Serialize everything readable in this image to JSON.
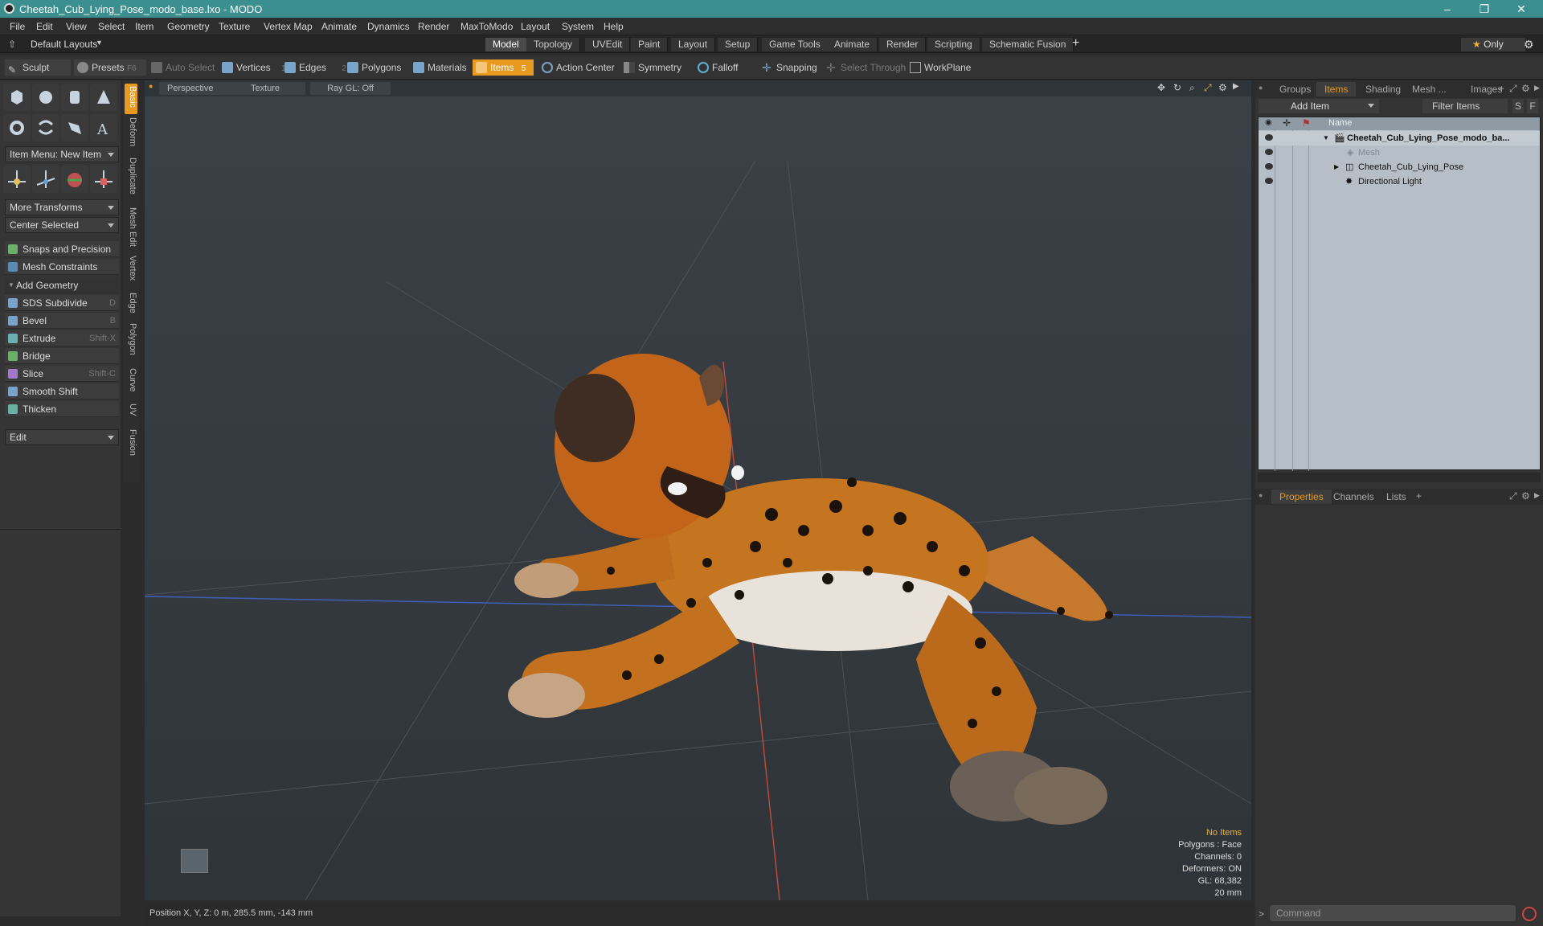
{
  "window": {
    "title": "Cheetah_Cub_Lying_Pose_modo_base.lxo - MODO",
    "controls": [
      "–",
      "❐",
      "✕"
    ]
  },
  "menu": [
    "File",
    "Edit",
    "View",
    "Select",
    "Item",
    "Geometry",
    "Texture",
    "Vertex Map",
    "Animate",
    "Dynamics",
    "Render",
    "MaxToModo",
    "Layout",
    "System",
    "Help"
  ],
  "layout_bar": {
    "layouts_label": "Default Layouts",
    "tabs": [
      "Model",
      "Topology",
      "UVEdit",
      "Paint",
      "Layout",
      "Setup",
      "Game Tools",
      "Animate",
      "Render",
      "Scripting",
      "Schematic Fusion"
    ],
    "active_tab": "Model",
    "only_label": "Only"
  },
  "toolbar": {
    "sculpt": "Sculpt",
    "presets": "Presets",
    "presets_key": "F6",
    "auto_select": "Auto Select",
    "vertices": "Vertices",
    "vertices_count": "1",
    "edges": "Edges",
    "edges_count": "2",
    "polygons": "Polygons",
    "materials": "Materials",
    "items": "Items",
    "items_count": "5",
    "action_center": "Action Center",
    "symmetry": "Symmetry",
    "falloff": "Falloff",
    "snapping": "Snapping",
    "select_through": "Select Through",
    "workplane": "WorkPlane"
  },
  "left_panel": {
    "item_menu": "Item Menu: New Item",
    "more_transforms": "More Transforms",
    "center_selected": "Center Selected",
    "snaps": "Snaps and Precision",
    "mesh_constraints": "Mesh Constraints",
    "add_geometry": "Add Geometry",
    "tools": [
      {
        "label": "SDS Subdivide",
        "shortcut": "D"
      },
      {
        "label": "Bevel",
        "shortcut": "B"
      },
      {
        "label": "Extrude",
        "shortcut": "Shift-X"
      },
      {
        "label": "Bridge",
        "shortcut": ""
      },
      {
        "label": "Slice",
        "shortcut": "Shift-C"
      },
      {
        "label": "Smooth Shift",
        "shortcut": ""
      },
      {
        "label": "Thicken",
        "shortcut": ""
      }
    ],
    "edit": "Edit",
    "vertical_tabs": [
      "Basic",
      "Deform",
      "Duplicate",
      "Mesh Edit",
      "Vertex",
      "Edge",
      "Polygon",
      "Curve",
      "UV",
      "Fusion"
    ]
  },
  "viewport": {
    "view_mode": "Perspective",
    "shading": "Texture",
    "raygl": "Ray GL: Off",
    "info": {
      "selection": "No Items",
      "polygons": "Polygons : Face",
      "channels": "Channels: 0",
      "deformers": "Deformers: ON",
      "gl": "GL: 68,382",
      "scale": "20 mm"
    }
  },
  "status": {
    "position": "Position X, Y, Z:  0 m, 285.5 mm, -143 mm"
  },
  "right_panel": {
    "tabs": [
      "Groups",
      "Items",
      "Shading",
      "Mesh ...",
      "Images"
    ],
    "active_tab": "Items",
    "add_item": "Add Item",
    "filter": "Filter Items",
    "filter_s": "S",
    "filter_f": "F",
    "col_name": "Name",
    "items": [
      {
        "name": "Cheetah_Cub_Lying_Pose_modo_ba...",
        "bold": true
      },
      {
        "name": "Mesh",
        "dim": true
      },
      {
        "name": "Cheetah_Cub_Lying_Pose"
      },
      {
        "name": "Directional Light"
      }
    ],
    "prop_tabs": [
      "Properties",
      "Channels",
      "Lists"
    ],
    "command_placeholder": "Command"
  }
}
